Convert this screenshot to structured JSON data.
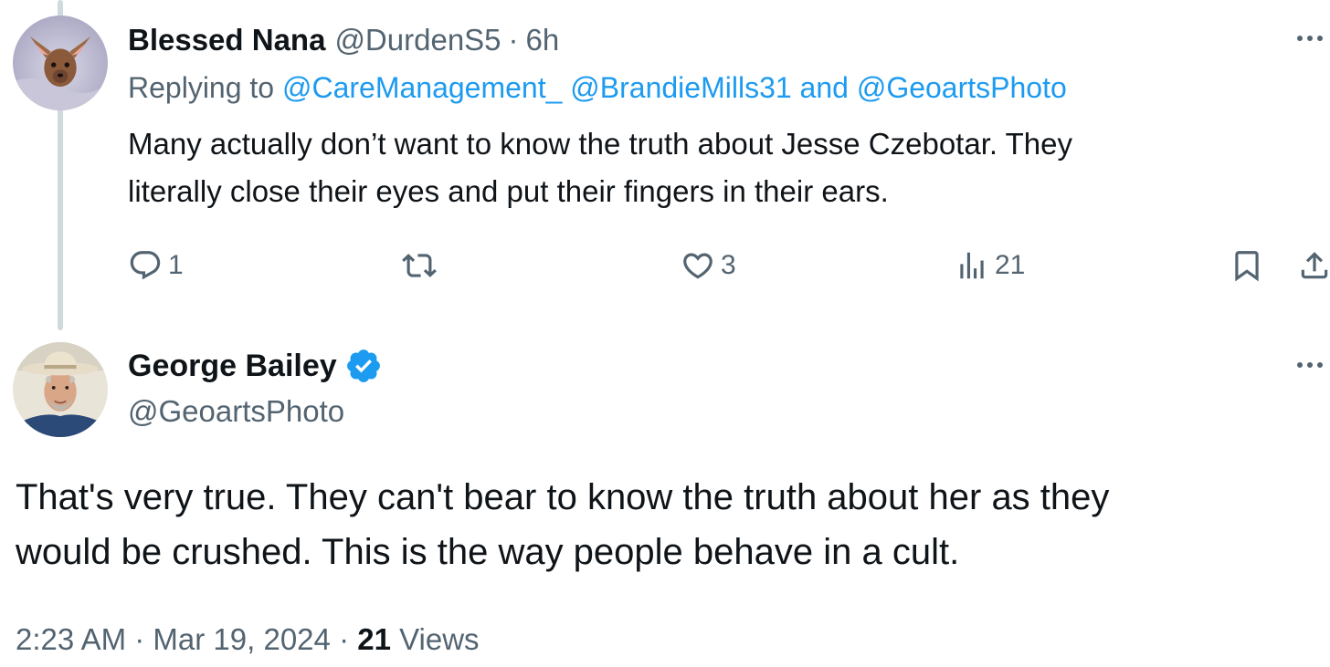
{
  "reply_tweet": {
    "display_name": "Blessed Nana",
    "handle": "@DurdenS5",
    "separator": "·",
    "time_ago": "6h",
    "replying_prefix": "Replying to",
    "mentions": [
      "@CareManagement_",
      "@BrandieMills31"
    ],
    "mentions_joiner": "and",
    "last_mention": "@GeoartsPhoto",
    "text_line1": "Many actually don’t want to know the truth about Jesse Czebotar. They",
    "text_line2": "literally close their eyes and put their fingers in their ears.",
    "actions": {
      "reply_count": "1",
      "retweet_count": "",
      "like_count": "3",
      "views_count": "21"
    }
  },
  "main_tweet": {
    "display_name": "George Bailey",
    "handle": "@GeoartsPhoto",
    "verified": true,
    "text_line1": "That's very true.  They can't bear to know the truth about her as they",
    "text_line2": "would be crushed.  This is the way people behave in a cult.",
    "time": "2:23 AM",
    "separator": "·",
    "date": "Mar 19, 2024",
    "views_number": "21",
    "views_label": "Views"
  },
  "colors": {
    "text": "#0f1419",
    "secondary": "#536471",
    "link": "#1d9bf0",
    "thread_line": "#cfd9de",
    "verified_badge": "#1d9bf0"
  },
  "icons": [
    "more-icon",
    "reply-icon",
    "retweet-icon",
    "like-icon",
    "views-icon",
    "bookmark-icon",
    "share-icon",
    "verified-badge-icon"
  ]
}
